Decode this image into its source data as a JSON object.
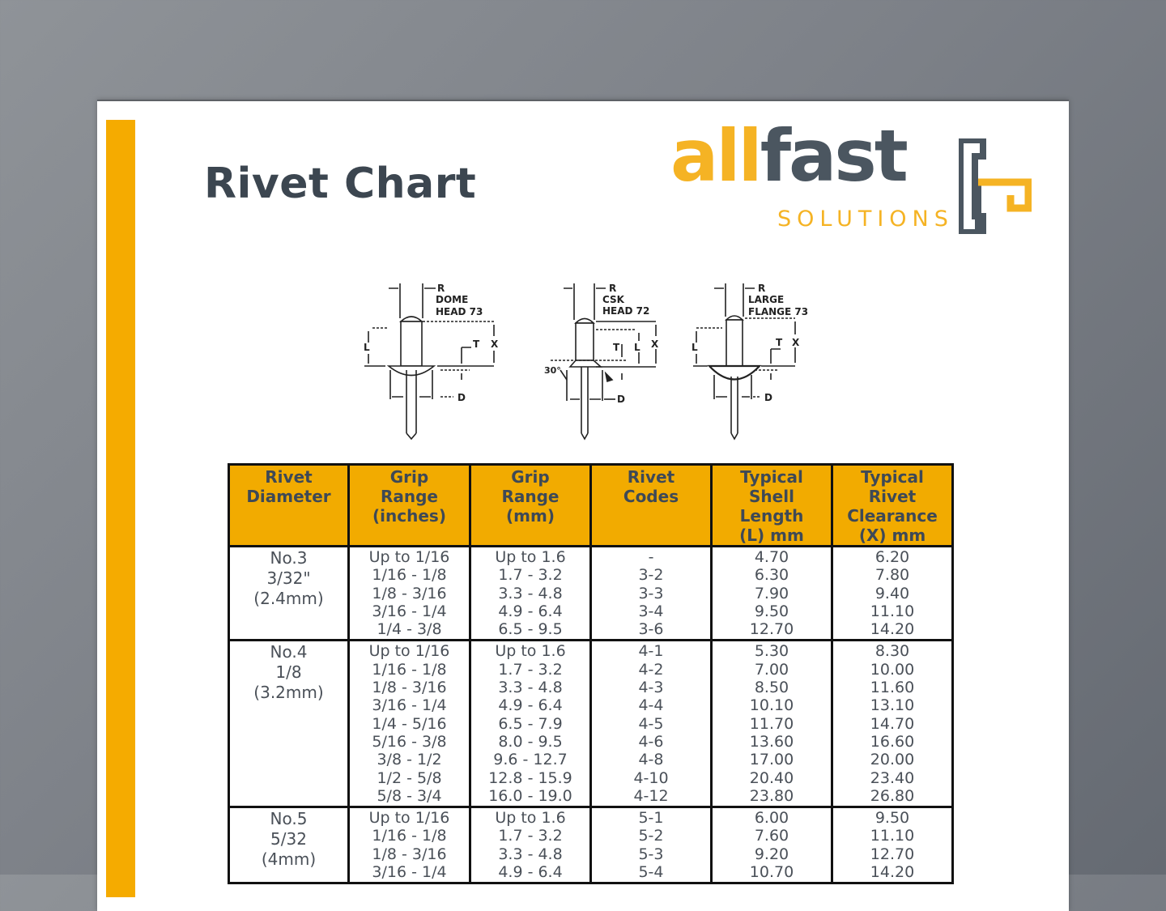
{
  "document": {
    "title": "Rivet Chart",
    "logo": {
      "word_part1": "all",
      "word_part2": "fast",
      "subtitle": "SOLUTIONS",
      "colors": {
        "yellow": "#f5b324",
        "slate": "#4b5660"
      }
    },
    "accent_color": "#f5ab00"
  },
  "diagrams": [
    {
      "name": "dome-head",
      "label_line1": "DOME",
      "label_line2": "HEAD 73",
      "dims": [
        "R",
        "L",
        "T",
        "X",
        "D"
      ]
    },
    {
      "name": "csk-head",
      "label_line1": "CSK",
      "label_line2": "HEAD 72",
      "angle": "30°",
      "dims": [
        "R",
        "L",
        "T",
        "X",
        "D"
      ]
    },
    {
      "name": "large-flange",
      "label_line1": "LARGE",
      "label_line2": "FLANGE 73",
      "dims": [
        "R",
        "L",
        "T",
        "X",
        "D"
      ]
    }
  ],
  "table": {
    "headers": [
      [
        "Rivet",
        "Diameter"
      ],
      [
        "Grip",
        "Range",
        "(inches)"
      ],
      [
        "Grip",
        "Range",
        "(mm)"
      ],
      [
        "Rivet",
        "Codes"
      ],
      [
        "Typical",
        "Shell",
        "Length",
        "(L) mm"
      ],
      [
        "Typical",
        "Rivet",
        "Clearance",
        "(X) mm"
      ]
    ],
    "groups": [
      {
        "diameter": [
          "No.3",
          "3/32\"",
          "(2.4mm)"
        ],
        "grip_in": [
          "Up to 1/16",
          "1/16 - 1/8",
          "1/8 - 3/16",
          "3/16 - 1/4",
          "1/4 - 3/8"
        ],
        "grip_mm": [
          "Up to 1.6",
          "1.7 - 3.2",
          "3.3 - 4.8",
          "4.9 - 6.4",
          "6.5 - 9.5"
        ],
        "codes": [
          "-",
          "3-2",
          "3-3",
          "3-4",
          "3-6"
        ],
        "shell_length": [
          "4.70",
          "6.30",
          "7.90",
          "9.50",
          "12.70"
        ],
        "clearance": [
          "6.20",
          "7.80",
          "9.40",
          "11.10",
          "14.20"
        ]
      },
      {
        "diameter": [
          "No.4",
          "1/8",
          "(3.2mm)"
        ],
        "grip_in": [
          "Up to 1/16",
          "1/16 - 1/8",
          "1/8 - 3/16",
          "3/16 - 1/4",
          "1/4 - 5/16",
          "5/16 - 3/8",
          "3/8 - 1/2",
          "1/2 - 5/8",
          "5/8 - 3/4"
        ],
        "grip_mm": [
          "Up to 1.6",
          "1.7 - 3.2",
          "3.3 - 4.8",
          "4.9 - 6.4",
          "6.5 - 7.9",
          "8.0 - 9.5",
          "9.6 - 12.7",
          "12.8 - 15.9",
          "16.0 - 19.0"
        ],
        "codes": [
          "4-1",
          "4-2",
          "4-3",
          "4-4",
          "4-5",
          "4-6",
          "4-8",
          "4-10",
          "4-12"
        ],
        "shell_length": [
          "5.30",
          "7.00",
          "8.50",
          "10.10",
          "11.70",
          "13.60",
          "17.00",
          "20.40",
          "23.80"
        ],
        "clearance": [
          "8.30",
          "10.00",
          "11.60",
          "13.10",
          "14.70",
          "16.60",
          "20.00",
          "23.40",
          "26.80"
        ]
      },
      {
        "diameter": [
          "No.5",
          "5/32",
          "(4mm)"
        ],
        "grip_in": [
          "Up to 1/16",
          "1/16 - 1/8",
          "1/8 - 3/16",
          "3/16 - 1/4"
        ],
        "grip_mm": [
          "Up to 1.6",
          "1.7 - 3.2",
          "3.3 - 4.8",
          "4.9 - 6.4"
        ],
        "codes": [
          "5-1",
          "5-2",
          "5-3",
          "5-4"
        ],
        "shell_length": [
          "6.00",
          "7.60",
          "9.20",
          "10.70"
        ],
        "clearance": [
          "9.50",
          "11.10",
          "12.70",
          "14.20"
        ]
      }
    ]
  }
}
